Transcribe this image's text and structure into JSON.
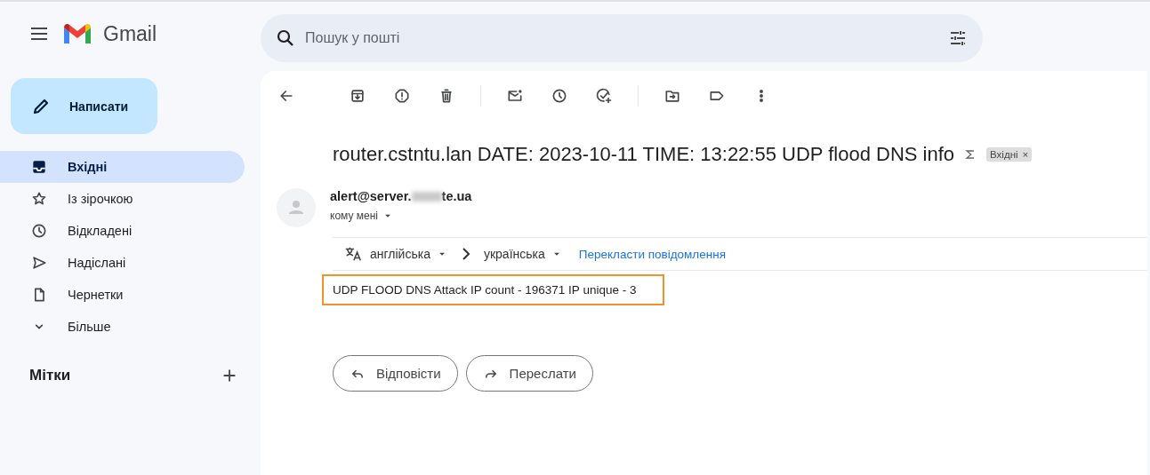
{
  "app": {
    "name": "Gmail"
  },
  "search": {
    "placeholder": "Пошук у пошті"
  },
  "compose": {
    "label": "Написати"
  },
  "sidebar": {
    "items": [
      {
        "label": "Вхідні",
        "kind": "inbox",
        "selected": true
      },
      {
        "label": "Із зірочкою",
        "kind": "star",
        "selected": false
      },
      {
        "label": "Відкладені",
        "kind": "clock",
        "selected": false
      },
      {
        "label": "Надіслані",
        "kind": "send",
        "selected": false
      },
      {
        "label": "Чернетки",
        "kind": "draft",
        "selected": false
      },
      {
        "label": "Більше",
        "kind": "more",
        "selected": false
      }
    ],
    "labels_heading": "Мітки"
  },
  "message": {
    "subject": "router.cstntu.lan DATE: 2023-10-11 TIME: 13:22:55 UDP flood DNS info",
    "label_chip": "Вхідні",
    "chip_close": "×",
    "sender_start": "alert@server.",
    "sender_end": "te.ua",
    "recipient": "кому мені",
    "translate": {
      "from": "англійська",
      "to": "українська",
      "action": "Перекласти повідомлення"
    },
    "body": "UDP FLOOD DNS Attack IP count - 196371 IP unique - 3"
  },
  "actions": [
    {
      "label": "Відповісти",
      "kind": "reply"
    },
    {
      "label": "Переслати",
      "kind": "forward"
    }
  ]
}
